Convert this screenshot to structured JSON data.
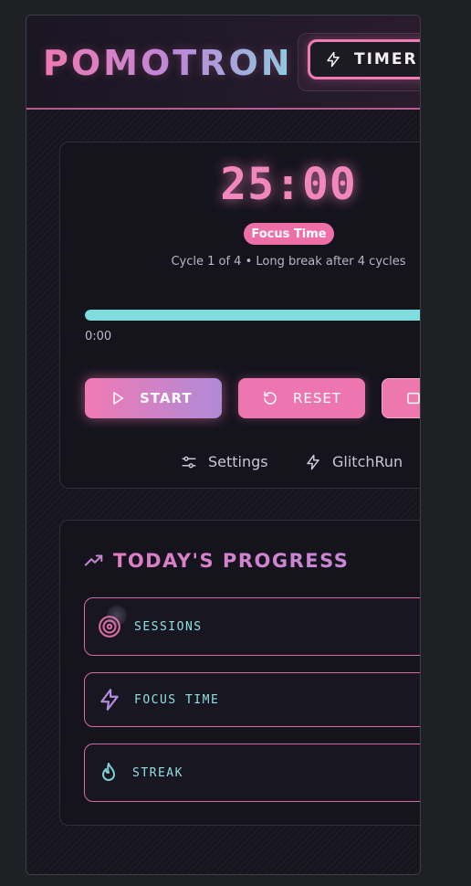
{
  "app": {
    "brand": "POMOTRON",
    "timer_tab_label": "TIMER"
  },
  "timer": {
    "time": "25:00",
    "mode": "Focus Time",
    "cycle_text": "Cycle 1 of 4 • Long break after 4 cycles",
    "progress_fraction": 1.0,
    "elapsed": "0:00",
    "buttons": {
      "start": "START",
      "reset": "RESET"
    },
    "links": {
      "settings": "Settings",
      "glitchrun": "GlitchRun"
    }
  },
  "progress": {
    "title": "TODAY'S PROGRESS",
    "stats": [
      {
        "label": "SESSIONS",
        "icon": "target-icon"
      },
      {
        "label": "FOCUS TIME",
        "icon": "lightning-icon"
      },
      {
        "label": "STREAK",
        "icon": "flame-icon"
      }
    ]
  },
  "colors": {
    "accent_pink": "#f07ab4",
    "accent_purple": "#b58be0",
    "accent_cyan": "#7fdcdf",
    "background": "#15141d"
  }
}
